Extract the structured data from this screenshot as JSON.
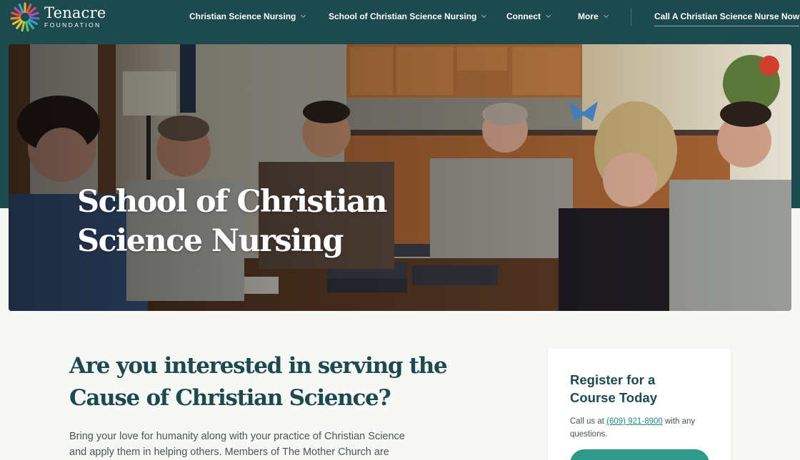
{
  "brand": {
    "name": "Tenacre",
    "sub": "FOUNDATION",
    "colors": {
      "primary": "#1d4a4e",
      "accent": "#2f9a88",
      "link": "#2a8a80"
    }
  },
  "nav": {
    "items": [
      {
        "label": "Christian Science Nursing",
        "has_menu": true
      },
      {
        "label": "School of Christian Science Nursing",
        "has_menu": true
      },
      {
        "label": "Connect",
        "has_menu": true
      },
      {
        "label": "More",
        "has_menu": true
      }
    ],
    "cta": "Call A Christian Science Nurse Now"
  },
  "hero": {
    "title_line1": "School of Christian",
    "title_line2": "Science Nursing"
  },
  "main": {
    "headline_line1": "Are you interested in serving the",
    "headline_line2": "Cause of Christian Science?",
    "intro_line1": "Bring your love for humanity along with your practice of Christian Science",
    "intro_line2": "and apply them in helping others. Members of The Mother Church are"
  },
  "card": {
    "title_line1": "Register for a",
    "title_line2": "Course Today",
    "text_before": "Call us at ",
    "phone": "(609) 921-8900",
    "text_after": " with any questions."
  }
}
